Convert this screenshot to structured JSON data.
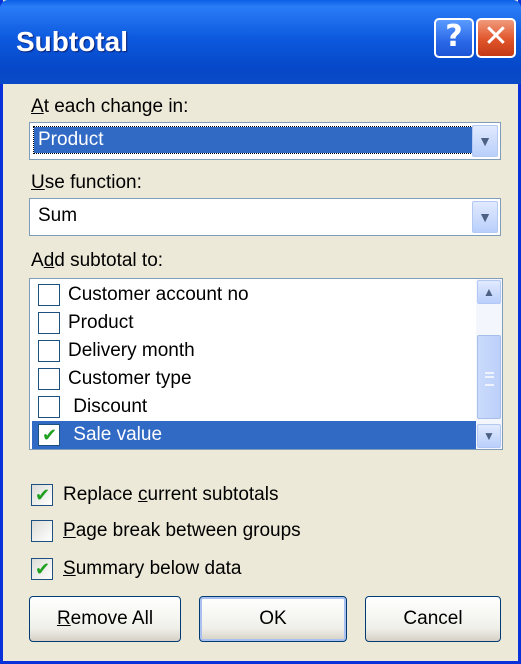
{
  "window": {
    "title": "Subtotal",
    "help_glyph": "?",
    "close_glyph": "✕"
  },
  "at_each_change": {
    "label_accel": "A",
    "label_rest": "t each change in:",
    "value": "Product"
  },
  "use_function": {
    "label_accel": "U",
    "label_rest": "se function:",
    "value": "Sum"
  },
  "add_subtotal": {
    "label_pre": "A",
    "label_accel": "d",
    "label_rest": "d subtotal to:",
    "items": [
      {
        "label": "Customer account no",
        "checked": false
      },
      {
        "label": "Product",
        "checked": false
      },
      {
        "label": "Delivery month",
        "checked": false
      },
      {
        "label": "Customer type",
        "checked": false
      },
      {
        "label": " Discount",
        "checked": false
      },
      {
        "label": " Sale value",
        "checked": true
      }
    ]
  },
  "options": {
    "replace": {
      "pre": "Replace ",
      "accel": "c",
      "rest": "urrent subtotals",
      "checked": true
    },
    "page_break": {
      "pre": "",
      "accel": "P",
      "rest": "age break between groups",
      "checked": false
    },
    "summary": {
      "pre": "",
      "accel": "S",
      "rest": "ummary below data",
      "checked": true
    }
  },
  "buttons": {
    "remove_all_accel": "R",
    "remove_all_rest": "emove All",
    "ok": "OK",
    "cancel": "Cancel"
  },
  "icons": {
    "dropdown": "chevron-down-icon",
    "scroll_up": "chevron-up-icon",
    "check": "checkmark-icon"
  },
  "colors": {
    "title_bar": "#0A5FE6",
    "selection": "#316AC5",
    "dialog_bg": "#ECE9D8",
    "close_button": "#E0542A",
    "check_green": "#21A121"
  }
}
